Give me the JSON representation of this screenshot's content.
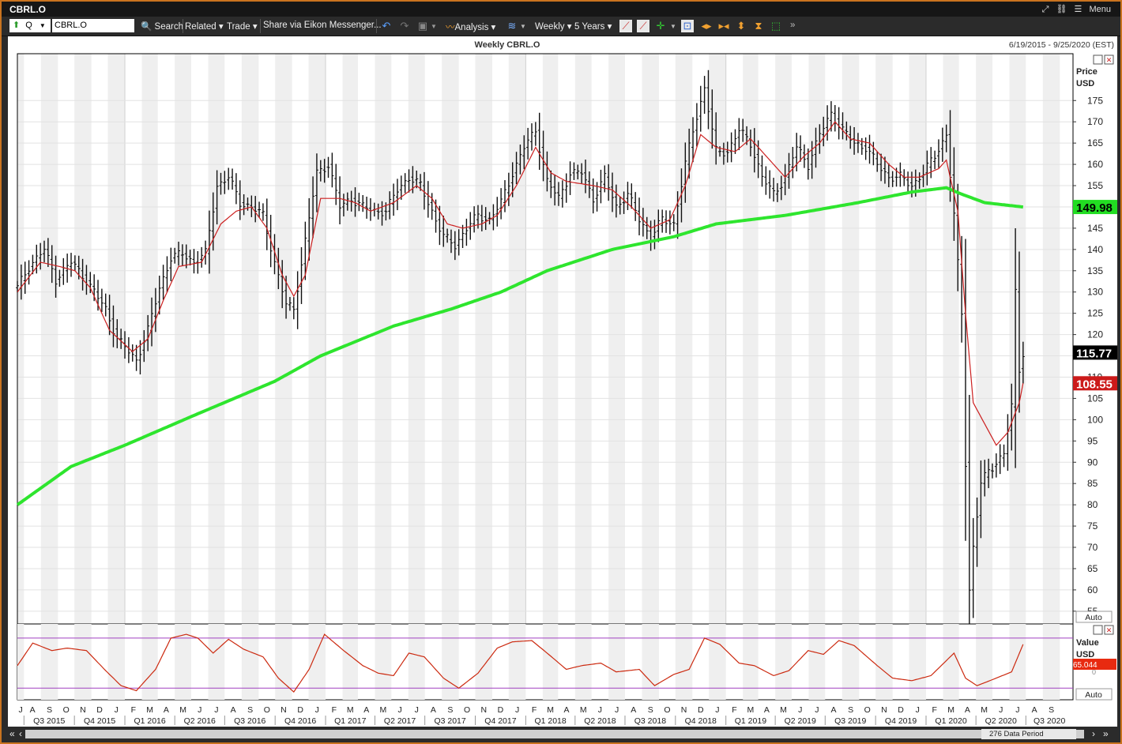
{
  "window": {
    "title": "CBRL.O",
    "menu_label": "Menu"
  },
  "toolbar": {
    "quote_type": "Q",
    "ric": "CBRL.O",
    "search_label": "Search",
    "related_label": "Related",
    "trade_label": "Trade",
    "share_label": "Share via Eikon Messenger...",
    "analysis_label": "Analysis",
    "interval_label": "Weekly",
    "range_label": "5 Years"
  },
  "status": {
    "data_period": "276 Data Period"
  },
  "chart_data": {
    "type": "line",
    "title": "Weekly CBRL.O",
    "date_range": "6/19/2015 - 9/25/2020 (EST)",
    "price_axis_label": "Price",
    "price_axis_unit": "USD",
    "ylim": [
      52,
      186
    ],
    "y_ticks": [
      55,
      60,
      65,
      70,
      75,
      80,
      85,
      90,
      95,
      100,
      105,
      110,
      115,
      120,
      125,
      130,
      135,
      140,
      145,
      150,
      155,
      160,
      165,
      170,
      175
    ],
    "auto_label": "Auto",
    "last_price": 115.77,
    "short_ma_last": 108.55,
    "long_ma_last": 149.98,
    "colors": {
      "price": "#000000",
      "short_ma": "#cc2020",
      "long_ma": "#2ee52e",
      "last_price_bg": "#000000",
      "short_ma_bg": "#cc1a1a",
      "long_ma_bg": "#22dd22"
    },
    "x_months": [
      "J",
      "A",
      "S",
      "O",
      "N",
      "D",
      "J",
      "F",
      "M",
      "A",
      "M",
      "J",
      "J",
      "A",
      "S",
      "O",
      "N",
      "D",
      "J",
      "F",
      "M",
      "A",
      "M",
      "J",
      "J",
      "A",
      "S",
      "O",
      "N",
      "D",
      "J",
      "F",
      "M",
      "A",
      "M",
      "J",
      "J",
      "A",
      "S",
      "O",
      "N",
      "D",
      "J",
      "F",
      "M",
      "A",
      "M",
      "J",
      "J",
      "A",
      "S",
      "O",
      "N",
      "D",
      "J",
      "F",
      "M",
      "A",
      "M",
      "J",
      "J",
      "A",
      "S"
    ],
    "x_quarters": [
      "Q3 2015",
      "Q4 2015",
      "Q1 2016",
      "Q2 2016",
      "Q3 2016",
      "Q4 2016",
      "Q1 2017",
      "Q2 2017",
      "Q3 2017",
      "Q4 2017",
      "Q1 2018",
      "Q2 2018",
      "Q3 2018",
      "Q4 2018",
      "Q1 2019",
      "Q2 2019",
      "Q3 2019",
      "Q4 2019",
      "Q1 2020",
      "Q2 2020",
      "Q3 2020"
    ],
    "price_series": {
      "name": "CBRL.O",
      "anchors": [
        [
          "2015-06-19",
          131
        ],
        [
          "2015-07-10",
          136
        ],
        [
          "2015-08-07",
          140
        ],
        [
          "2015-08-28",
          133
        ],
        [
          "2015-09-25",
          137
        ],
        [
          "2015-10-16",
          134
        ],
        [
          "2015-11-06",
          130
        ],
        [
          "2015-11-27",
          126
        ],
        [
          "2015-12-18",
          119
        ],
        [
          "2016-01-08",
          116
        ],
        [
          "2016-01-22",
          114
        ],
        [
          "2016-02-12",
          121
        ],
        [
          "2016-03-04",
          131
        ],
        [
          "2016-03-25",
          138
        ],
        [
          "2016-04-15",
          139
        ],
        [
          "2016-05-06",
          137
        ],
        [
          "2016-05-27",
          139
        ],
        [
          "2016-06-17",
          155
        ],
        [
          "2016-07-08",
          157
        ],
        [
          "2016-07-29",
          151
        ],
        [
          "2016-08-19",
          150
        ],
        [
          "2016-09-09",
          148
        ],
        [
          "2016-09-30",
          137
        ],
        [
          "2016-10-21",
          127
        ],
        [
          "2016-11-04",
          126
        ],
        [
          "2016-11-25",
          142
        ],
        [
          "2016-12-16",
          158
        ],
        [
          "2017-01-06",
          160
        ],
        [
          "2017-01-27",
          150
        ],
        [
          "2017-02-17",
          152
        ],
        [
          "2017-03-10",
          150
        ],
        [
          "2017-03-31",
          149
        ],
        [
          "2017-04-21",
          149
        ],
        [
          "2017-05-12",
          154
        ],
        [
          "2017-06-02",
          157
        ],
        [
          "2017-06-23",
          155
        ],
        [
          "2017-07-14",
          149
        ],
        [
          "2017-08-04",
          143
        ],
        [
          "2017-08-25",
          141
        ],
        [
          "2017-09-15",
          145
        ],
        [
          "2017-10-06",
          148
        ],
        [
          "2017-10-27",
          147
        ],
        [
          "2017-11-17",
          151
        ],
        [
          "2017-12-08",
          158
        ],
        [
          "2017-12-29",
          164
        ],
        [
          "2018-01-19",
          168
        ],
        [
          "2018-02-09",
          156
        ],
        [
          "2018-03-02",
          152
        ],
        [
          "2018-03-23",
          158
        ],
        [
          "2018-04-13",
          158
        ],
        [
          "2018-05-04",
          152
        ],
        [
          "2018-05-25",
          157
        ],
        [
          "2018-06-15",
          150
        ],
        [
          "2018-07-06",
          153
        ],
        [
          "2018-07-27",
          147
        ],
        [
          "2018-08-17",
          143
        ],
        [
          "2018-09-07",
          147
        ],
        [
          "2018-09-28",
          146
        ],
        [
          "2018-10-19",
          160
        ],
        [
          "2018-11-02",
          168
        ],
        [
          "2018-11-23",
          178
        ],
        [
          "2018-12-14",
          163
        ],
        [
          "2019-01-04",
          163
        ],
        [
          "2019-01-25",
          168
        ],
        [
          "2019-02-15",
          165
        ],
        [
          "2019-03-08",
          157
        ],
        [
          "2019-03-29",
          153
        ],
        [
          "2019-04-19",
          157
        ],
        [
          "2019-05-10",
          164
        ],
        [
          "2019-05-31",
          160
        ],
        [
          "2019-06-21",
          167
        ],
        [
          "2019-07-12",
          172
        ],
        [
          "2019-08-02",
          168
        ],
        [
          "2019-08-23",
          165
        ],
        [
          "2019-09-13",
          164
        ],
        [
          "2019-10-04",
          160
        ],
        [
          "2019-10-25",
          157
        ],
        [
          "2019-11-15",
          157
        ],
        [
          "2019-12-06",
          155
        ],
        [
          "2019-12-27",
          158
        ],
        [
          "2020-01-17",
          162
        ],
        [
          "2020-02-07",
          167
        ],
        [
          "2020-02-21",
          148
        ],
        [
          "2020-03-06",
          125
        ],
        [
          "2020-03-13",
          90
        ],
        [
          "2020-03-20",
          60
        ],
        [
          "2020-03-27",
          70
        ],
        [
          "2020-04-10",
          85
        ],
        [
          "2020-04-24",
          88
        ],
        [
          "2020-05-08",
          90
        ],
        [
          "2020-05-22",
          92
        ],
        [
          "2020-06-05",
          103
        ],
        [
          "2020-06-12",
          130
        ],
        [
          "2020-06-19",
          112
        ],
        [
          "2020-06-26",
          115.77
        ]
      ]
    },
    "short_ma_series": {
      "anchors": [
        [
          "2015-06-19",
          130
        ],
        [
          "2015-07-31",
          137
        ],
        [
          "2015-09-04",
          136
        ],
        [
          "2015-10-02",
          135
        ],
        [
          "2015-10-30",
          131
        ],
        [
          "2015-12-04",
          121
        ],
        [
          "2016-01-15",
          116
        ],
        [
          "2016-02-12",
          119
        ],
        [
          "2016-03-11",
          128
        ],
        [
          "2016-04-08",
          136
        ],
        [
          "2016-05-20",
          137
        ],
        [
          "2016-06-24",
          146
        ],
        [
          "2016-07-22",
          149
        ],
        [
          "2016-08-19",
          150
        ],
        [
          "2016-09-16",
          145
        ],
        [
          "2016-10-14",
          134
        ],
        [
          "2016-11-04",
          129
        ],
        [
          "2016-11-25",
          134
        ],
        [
          "2016-12-23",
          152
        ],
        [
          "2017-01-27",
          152
        ],
        [
          "2017-02-24",
          151
        ],
        [
          "2017-03-24",
          149
        ],
        [
          "2017-05-05",
          151
        ],
        [
          "2017-06-16",
          155
        ],
        [
          "2017-07-14",
          152
        ],
        [
          "2017-08-11",
          146
        ],
        [
          "2017-09-08",
          145
        ],
        [
          "2017-10-13",
          146
        ],
        [
          "2017-11-10",
          148
        ],
        [
          "2017-12-15",
          155
        ],
        [
          "2018-01-19",
          164
        ],
        [
          "2018-02-16",
          158
        ],
        [
          "2018-03-16",
          156
        ],
        [
          "2018-05-04",
          155
        ],
        [
          "2018-06-08",
          154
        ],
        [
          "2018-07-13",
          150
        ],
        [
          "2018-08-17",
          145
        ],
        [
          "2018-09-21",
          147
        ],
        [
          "2018-10-19",
          155
        ],
        [
          "2018-11-16",
          167
        ],
        [
          "2018-12-14",
          164
        ],
        [
          "2019-01-18",
          163
        ],
        [
          "2019-02-15",
          166
        ],
        [
          "2019-03-15",
          162
        ],
        [
          "2019-04-19",
          157
        ],
        [
          "2019-05-24",
          162
        ],
        [
          "2019-06-21",
          165
        ],
        [
          "2019-07-19",
          170
        ],
        [
          "2019-08-16",
          166
        ],
        [
          "2019-09-20",
          165
        ],
        [
          "2019-10-25",
          160
        ],
        [
          "2019-11-22",
          157
        ],
        [
          "2019-12-20",
          157
        ],
        [
          "2020-01-24",
          159
        ],
        [
          "2020-02-07",
          161
        ],
        [
          "2020-02-28",
          149
        ],
        [
          "2020-03-13",
          125
        ],
        [
          "2020-03-27",
          104
        ],
        [
          "2020-04-17",
          99
        ],
        [
          "2020-05-08",
          94
        ],
        [
          "2020-05-29",
          97
        ],
        [
          "2020-06-19",
          104
        ],
        [
          "2020-06-26",
          108.55
        ]
      ]
    },
    "long_ma_series": {
      "anchors": [
        [
          "2015-06-19",
          80
        ],
        [
          "2015-09-25",
          89
        ],
        [
          "2016-01-01",
          94
        ],
        [
          "2016-05-06",
          101
        ],
        [
          "2016-09-30",
          109
        ],
        [
          "2016-12-23",
          115
        ],
        [
          "2017-05-05",
          122
        ],
        [
          "2017-08-18",
          126
        ],
        [
          "2017-11-17",
          130
        ],
        [
          "2018-02-09",
          135
        ],
        [
          "2018-06-08",
          140
        ],
        [
          "2018-09-28",
          143
        ],
        [
          "2018-12-14",
          146
        ],
        [
          "2019-04-19",
          148
        ],
        [
          "2019-08-30",
          151
        ],
        [
          "2019-12-06",
          153.5
        ],
        [
          "2020-02-07",
          154.5
        ],
        [
          "2020-03-06",
          153
        ],
        [
          "2020-04-17",
          151
        ],
        [
          "2020-06-26",
          149.98
        ]
      ]
    },
    "oscillator": {
      "label": "Value",
      "unit": "USD",
      "last": "65.044",
      "tick_label": "0",
      "auto_label": "Auto",
      "upper_level": 70,
      "lower_level": 30,
      "ylim": [
        22,
        80
      ],
      "anchors": [
        [
          "2015-06-19",
          48
        ],
        [
          "2015-07-17",
          66
        ],
        [
          "2015-08-21",
          60
        ],
        [
          "2015-09-18",
          62
        ],
        [
          "2015-10-23",
          60
        ],
        [
          "2015-11-27",
          44
        ],
        [
          "2015-12-25",
          32
        ],
        [
          "2016-01-22",
          28
        ],
        [
          "2016-02-26",
          45
        ],
        [
          "2016-03-25",
          70
        ],
        [
          "2016-04-22",
          73
        ],
        [
          "2016-05-13",
          70
        ],
        [
          "2016-06-10",
          58
        ],
        [
          "2016-07-08",
          69
        ],
        [
          "2016-08-05",
          61
        ],
        [
          "2016-09-09",
          55
        ],
        [
          "2016-10-07",
          38
        ],
        [
          "2016-11-04",
          27
        ],
        [
          "2016-12-02",
          45
        ],
        [
          "2016-12-30",
          73
        ],
        [
          "2017-02-03",
          60
        ],
        [
          "2017-03-10",
          48
        ],
        [
          "2017-04-07",
          42
        ],
        [
          "2017-05-05",
          40
        ],
        [
          "2017-06-02",
          58
        ],
        [
          "2017-06-30",
          55
        ],
        [
          "2017-08-04",
          38
        ],
        [
          "2017-09-01",
          30
        ],
        [
          "2017-10-06",
          42
        ],
        [
          "2017-11-10",
          62
        ],
        [
          "2017-12-08",
          67
        ],
        [
          "2018-01-12",
          68
        ],
        [
          "2018-02-09",
          58
        ],
        [
          "2018-03-16",
          45
        ],
        [
          "2018-04-13",
          48
        ],
        [
          "2018-05-18",
          50
        ],
        [
          "2018-06-15",
          43
        ],
        [
          "2018-07-27",
          45
        ],
        [
          "2018-08-24",
          32
        ],
        [
          "2018-09-28",
          41
        ],
        [
          "2018-10-26",
          45
        ],
        [
          "2018-11-23",
          70
        ],
        [
          "2018-12-21",
          65
        ],
        [
          "2019-01-25",
          50
        ],
        [
          "2019-02-22",
          48
        ],
        [
          "2019-03-29",
          40
        ],
        [
          "2019-04-26",
          44
        ],
        [
          "2019-05-31",
          60
        ],
        [
          "2019-06-28",
          57
        ],
        [
          "2019-07-26",
          68
        ],
        [
          "2019-08-23",
          64
        ],
        [
          "2019-10-04",
          48
        ],
        [
          "2019-11-01",
          38
        ],
        [
          "2019-12-06",
          36
        ],
        [
          "2020-01-10",
          40
        ],
        [
          "2020-02-07",
          52
        ],
        [
          "2020-02-21",
          58
        ],
        [
          "2020-03-13",
          38
        ],
        [
          "2020-04-03",
          32
        ],
        [
          "2020-05-08",
          38
        ],
        [
          "2020-06-05",
          43
        ],
        [
          "2020-06-26",
          65
        ]
      ]
    }
  }
}
